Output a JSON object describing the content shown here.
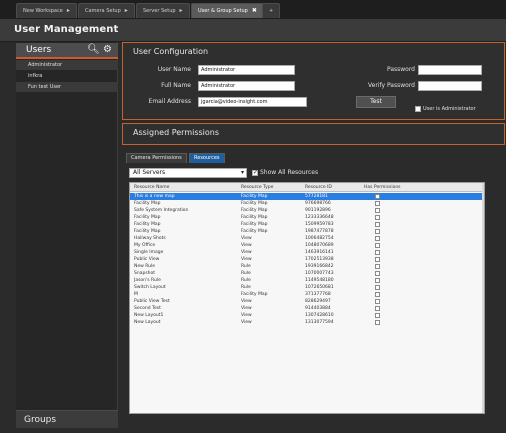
{
  "tabs": [
    {
      "label": "New Workspace",
      "close": "▸",
      "active": false
    },
    {
      "label": "Camera Setup",
      "close": "▸",
      "active": false
    },
    {
      "label": "Server Setup",
      "close": "▸",
      "active": false
    },
    {
      "label": "User & Group Setup",
      "close": "✖",
      "active": true
    },
    {
      "label": "+",
      "close": "",
      "active": false
    }
  ],
  "window": {
    "title": "User Management"
  },
  "sidebar": {
    "header": "Users",
    "icons": [
      "search-icon",
      "gear-icon"
    ],
    "items": [
      {
        "label": "Administrator"
      },
      {
        "label": "infkra"
      },
      {
        "label": "Fun test User"
      }
    ],
    "footer": "Groups"
  },
  "user_config": {
    "title": "User Configuration",
    "labels": {
      "user_name": "User Name",
      "full_name": "Full Name",
      "email": "Email Address",
      "password": "Password",
      "verify_password": "Verify Password"
    },
    "values": {
      "user_name": "Administrator",
      "full_name": "Administrator",
      "email": "jgarcia@video-insight.com",
      "password": "",
      "verify_password": ""
    },
    "test_button": "Test",
    "is_admin_label": "User is Administrator"
  },
  "permissions": {
    "title": "Assigned Permissions",
    "subtabs": [
      "Camera Permissions",
      "Resources"
    ],
    "server_select": "All Servers",
    "show_all_label": "Show All Resources",
    "table": {
      "headers": [
        "Resource Name",
        "Resource Type",
        "Resource ID",
        "Has Permissions"
      ],
      "rows": [
        [
          "This is a new map",
          "Facility Map",
          "57728181",
          "",
          true
        ],
        [
          "Facility Map",
          "Facility Map",
          "976698766",
          "",
          false
        ],
        [
          "Safe System Integration",
          "Facility Map",
          "901192896",
          "",
          false
        ],
        [
          "Facility Map",
          "Facility Map",
          "1233336648",
          "",
          false
        ],
        [
          "Facility Map",
          "Facility Map",
          "1509959783",
          "",
          false
        ],
        [
          "Facility Map",
          "Facility Map",
          "1987477878",
          "",
          false
        ],
        [
          "Hallway Shots",
          "View",
          "1006482754",
          "",
          false
        ],
        [
          "My Office",
          "View",
          "1048070689",
          "",
          false
        ],
        [
          "Single Image",
          "View",
          "1463916141",
          "",
          false
        ],
        [
          "Public View",
          "View",
          "1702513938",
          "",
          false
        ],
        [
          "New Rule",
          "Rule",
          "1939166842",
          "",
          false
        ],
        [
          "Snapshot",
          "Rule",
          "1070007743",
          "",
          false
        ],
        [
          "Jason's Rule",
          "Rule",
          "1149548180",
          "",
          false
        ],
        [
          "Switch Layout",
          "Rule",
          "1072650681",
          "",
          false
        ],
        [
          "M",
          "Facility Map",
          "371377768",
          "",
          false
        ],
        [
          "Public View Test",
          "View",
          "828629497",
          "",
          false
        ],
        [
          "Second Test",
          "View",
          "914403884",
          "",
          false
        ],
        [
          "New Layout1",
          "View",
          "1307428610",
          "",
          false
        ],
        [
          "New Layout",
          "View",
          "1313077594",
          "",
          false
        ]
      ]
    }
  },
  "colors": {
    "accent": "#d05a2b",
    "selection": "#2a7de1",
    "panel_bg": "#2f2f2f"
  }
}
